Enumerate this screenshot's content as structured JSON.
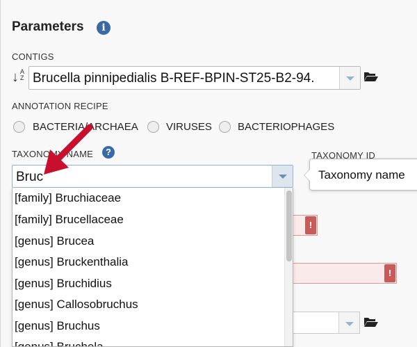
{
  "header": {
    "title": "Parameters",
    "info_icon_glyph": "i"
  },
  "contigs": {
    "label": "CONTIGS",
    "sort_az_glyph": "A\nZ",
    "value": "Brucella pinnipedialis B-REF-BPIN-ST25-B2-94."
  },
  "annotation": {
    "label": "ANNOTATION RECIPE",
    "options": [
      "BACTERIA/ARCHAEA",
      "VIRUSES",
      "BACTERIOPHAGES"
    ]
  },
  "taxonomy": {
    "name_label": "TAXONOMY NAME",
    "help_glyph": "?",
    "id_label": "TAXONOMY ID",
    "input_value": "Bruc",
    "tooltip": "Taxonomy name",
    "suggestions": [
      "[family] Bruchiaceae",
      "[family] Brucellaceae",
      "[genus] Brucea",
      "[genus] Bruckenthalia",
      "[genus] Bruchidius",
      "[genus] Callosobruchus",
      "[genus] Bruchus",
      "[genus] Bruchela"
    ]
  },
  "error_badge_glyph": "!",
  "colors": {
    "accent": "#3a6aa6",
    "arrow": "#c8102e",
    "error": "#c85a5a"
  },
  "icons": [
    "info-icon",
    "sort-az-icon",
    "folder-open-icon",
    "help-icon",
    "chevron-down-icon",
    "error-icon",
    "annotation-arrow"
  ]
}
